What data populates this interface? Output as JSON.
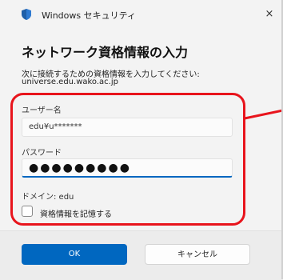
{
  "window": {
    "title": "Windows セキュリティ",
    "close_glyph": "×"
  },
  "dialog": {
    "heading": "ネットワーク資格情報の入力",
    "instruction": "次に接続するための資格情報を入力してください:",
    "server": "universe.edu.wako.ac.jp"
  },
  "form": {
    "username_label": "ユーザー名",
    "username_value": "edu¥u*******",
    "password_label": "パスワード",
    "password_value": "●●●●●●●●●",
    "domain_text": "ドメイン: edu",
    "remember_label": "資格情報を記憶する",
    "remember_checked": false
  },
  "buttons": {
    "ok": "OK",
    "cancel": "キャンセル"
  },
  "colors": {
    "accent": "#0067c0",
    "annotation": "#e8141c"
  },
  "icons": {
    "title_icon": "shield-icon",
    "close_icon": "close-icon"
  }
}
